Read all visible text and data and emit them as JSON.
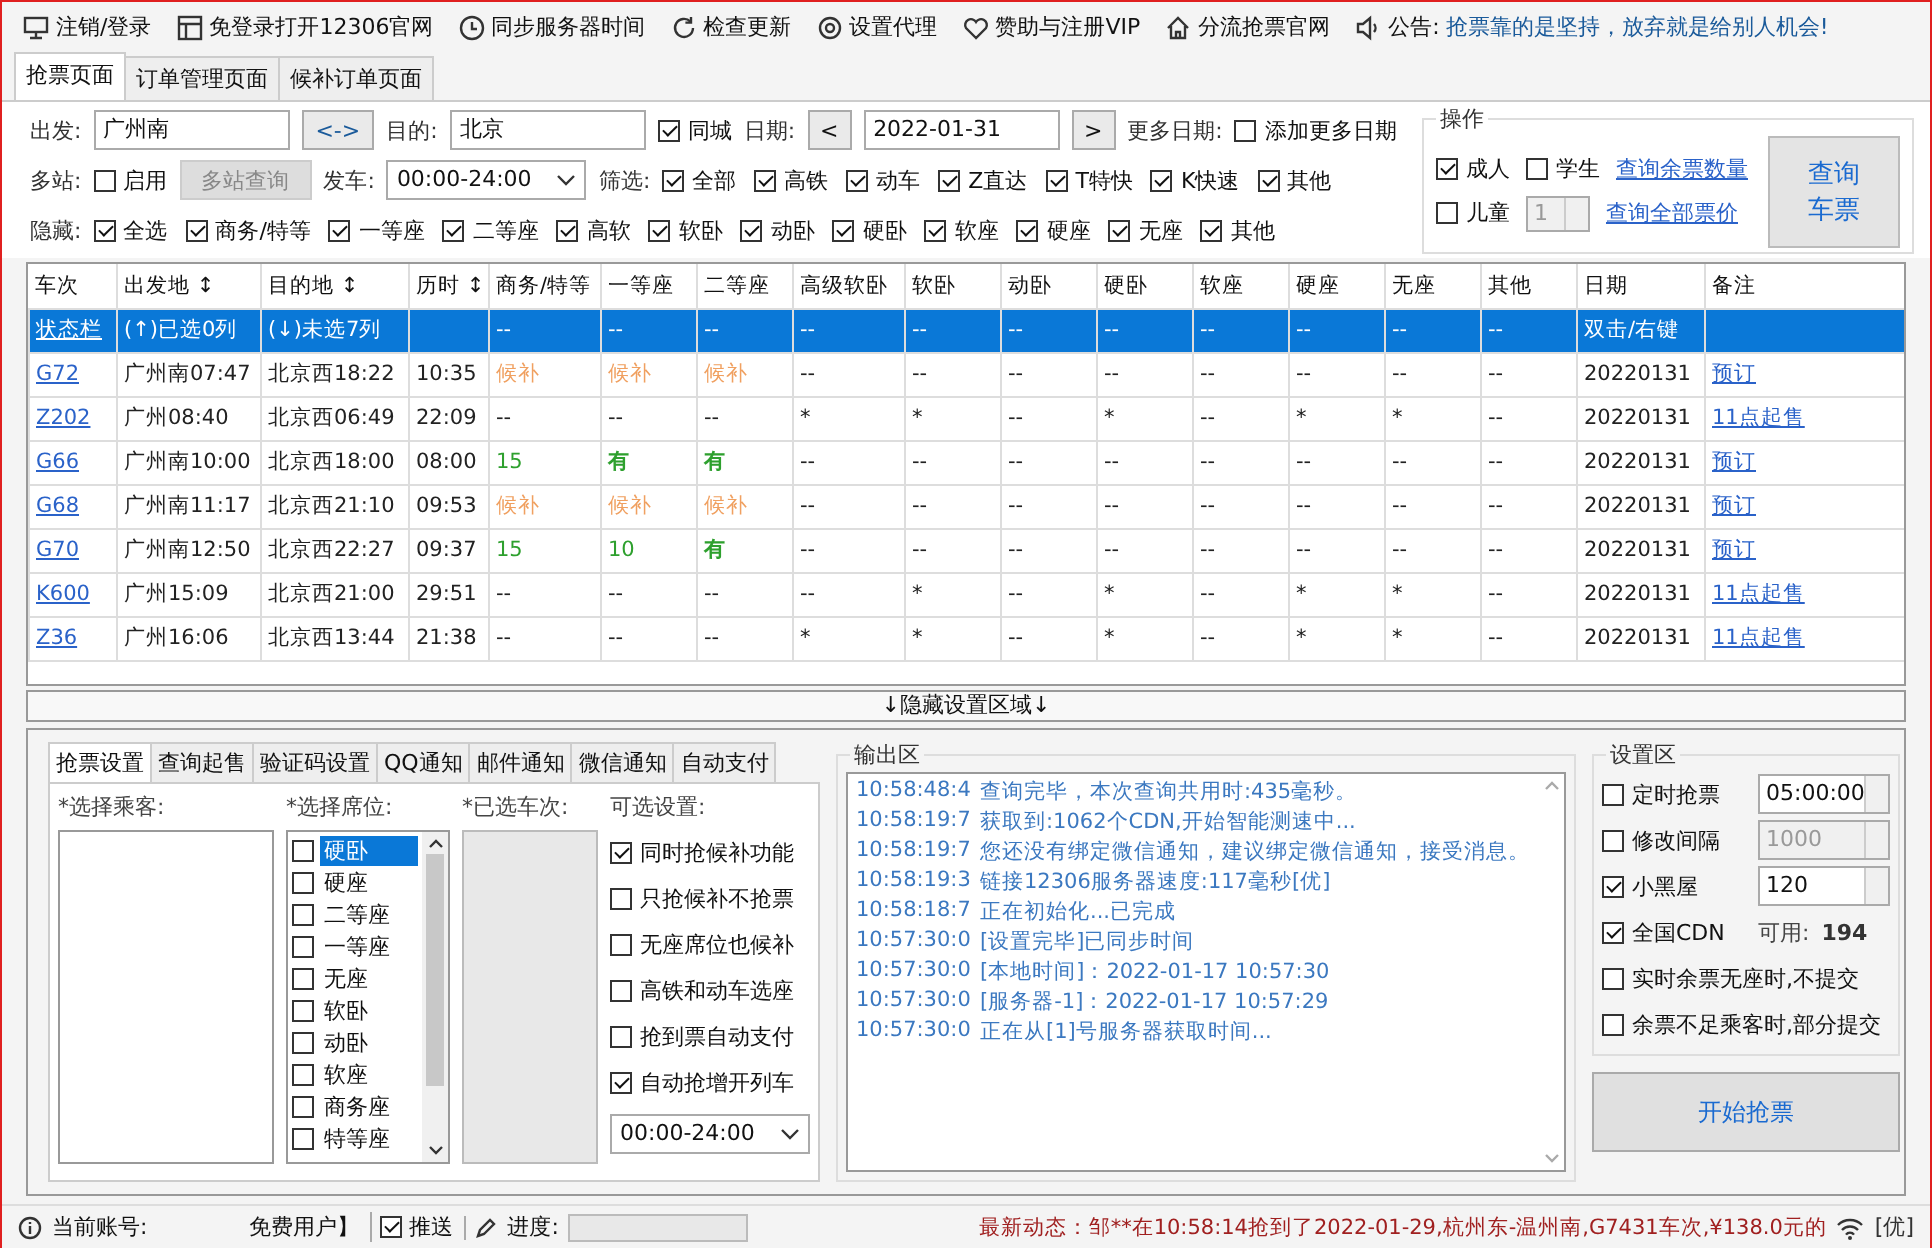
{
  "toolbar": {
    "items": [
      {
        "label": "注销/登录"
      },
      {
        "label": "免登录打开12306官网"
      },
      {
        "label": "同步服务器时间"
      },
      {
        "label": "检查更新"
      },
      {
        "label": "设置代理"
      },
      {
        "label": "赞助与注册VIP"
      },
      {
        "label": "分流抢票官网"
      }
    ],
    "notice": {
      "label": "公告:",
      "text": "抢票靠的是坚持，放弃就是给别人机会!"
    }
  },
  "tabs": [
    {
      "label": "抢票页面",
      "selected": true
    },
    {
      "label": "订单管理页面",
      "selected": false
    },
    {
      "label": "候补订单页面",
      "selected": false
    }
  ],
  "query": {
    "from_label": "出发:",
    "from": "广州南",
    "swap": "<->",
    "to_label": "目的:",
    "to": "北京",
    "same_city": {
      "label": "同城",
      "checked": true
    },
    "date_label": "日期:",
    "prev": "<",
    "date": "2022-01-31",
    "next": ">",
    "more_label": "更多日期:",
    "add_more": {
      "label": "添加更多日期",
      "checked": false
    },
    "multi_label": "多站:",
    "multi_enable": {
      "label": "启用",
      "checked": false
    },
    "multi_button": {
      "label": "多站查询",
      "disabled": true
    },
    "depart_label": "发车:",
    "depart_time": "00:00-24:00",
    "filter_label": "筛选:",
    "filters": [
      {
        "label": "全部",
        "checked": true
      },
      {
        "label": "高铁",
        "checked": true
      },
      {
        "label": "动车",
        "checked": true
      },
      {
        "label": "Z直达",
        "checked": true
      },
      {
        "label": "T特快",
        "checked": true
      },
      {
        "label": "K快速",
        "checked": true
      },
      {
        "label": "其他",
        "checked": true
      }
    ],
    "hide_label": "隐藏:",
    "hide": [
      {
        "label": "全选",
        "checked": true
      },
      {
        "label": "商务/特等",
        "checked": true
      },
      {
        "label": "一等座",
        "checked": true
      },
      {
        "label": "二等座",
        "checked": true
      },
      {
        "label": "高软",
        "checked": true
      },
      {
        "label": "软卧",
        "checked": true
      },
      {
        "label": "动卧",
        "checked": true
      },
      {
        "label": "硬卧",
        "checked": true
      },
      {
        "label": "软座",
        "checked": true
      },
      {
        "label": "硬座",
        "checked": true
      },
      {
        "label": "无座",
        "checked": true
      },
      {
        "label": "其他",
        "checked": true
      }
    ]
  },
  "operations": {
    "title": "操作",
    "adult": {
      "label": "成人",
      "checked": true
    },
    "student": {
      "label": "学生",
      "checked": false
    },
    "child": {
      "label": "儿童",
      "checked": false
    },
    "child_count": {
      "value": "1",
      "disabled": true
    },
    "links": [
      "查询余票数量",
      "查询全部票价"
    ],
    "query_button": [
      "查询",
      "车票"
    ]
  },
  "table": {
    "columns": [
      {
        "label": "车次",
        "kind": "link"
      },
      {
        "label": "出发地 ↕",
        "kind": "text"
      },
      {
        "label": "目的地 ↕",
        "kind": "text"
      },
      {
        "label": "历时 ↕",
        "kind": "text"
      },
      {
        "label": "商务/特等",
        "kind": "text"
      },
      {
        "label": "一等座",
        "kind": "text"
      },
      {
        "label": "二等座",
        "kind": "text"
      },
      {
        "label": "高级软卧",
        "kind": "text"
      },
      {
        "label": "软卧",
        "kind": "text"
      },
      {
        "label": "动卧",
        "kind": "text"
      },
      {
        "label": "硬卧",
        "kind": "text"
      },
      {
        "label": "软座",
        "kind": "text"
      },
      {
        "label": "硬座",
        "kind": "text"
      },
      {
        "label": "无座",
        "kind": "text"
      },
      {
        "label": "其他",
        "kind": "text"
      },
      {
        "label": "日期",
        "kind": "text"
      },
      {
        "label": "备注",
        "kind": "link"
      }
    ],
    "rows": [
      {
        "selected": true,
        "cells": [
          "状态栏",
          "(↑)已选0列",
          "(↓)未选7列",
          null,
          "--",
          "--",
          "--",
          "--",
          "--",
          "--",
          "--",
          "--",
          "--",
          "--",
          "--",
          "双击/右键",
          null
        ]
      },
      {
        "selected": false,
        "cells": [
          "G72",
          "广州南07:47",
          "北京西18:22",
          "10:35",
          {
            "text": "候补",
            "kind": "waitlist"
          },
          {
            "text": "候补",
            "kind": "waitlist"
          },
          {
            "text": "候补",
            "kind": "waitlist"
          },
          "--",
          "--",
          "--",
          "--",
          "--",
          "--",
          "--",
          "--",
          "20220131",
          "预订"
        ]
      },
      {
        "selected": false,
        "cells": [
          "Z202",
          "广州08:40",
          "北京西06:49",
          "22:09",
          "--",
          "--",
          "--",
          "*",
          "*",
          "--",
          "*",
          "--",
          "*",
          "*",
          "--",
          "20220131",
          "11点起售"
        ]
      },
      {
        "selected": false,
        "cells": [
          "G66",
          "广州南10:00",
          "北京西18:00",
          "08:00",
          {
            "text": "15",
            "kind": "available"
          },
          {
            "text": "有",
            "kind": "available_bold"
          },
          {
            "text": "有",
            "kind": "available_bold"
          },
          "--",
          "--",
          "--",
          "--",
          "--",
          "--",
          "--",
          "--",
          "20220131",
          "预订"
        ]
      },
      {
        "selected": false,
        "cells": [
          "G68",
          "广州南11:17",
          "北京西21:10",
          "09:53",
          {
            "text": "候补",
            "kind": "waitlist"
          },
          {
            "text": "候补",
            "kind": "waitlist"
          },
          {
            "text": "候补",
            "kind": "waitlist"
          },
          "--",
          "--",
          "--",
          "--",
          "--",
          "--",
          "--",
          "--",
          "20220131",
          "预订"
        ]
      },
      {
        "selected": false,
        "cells": [
          "G70",
          "广州南12:50",
          "北京西22:27",
          "09:37",
          {
            "text": "15",
            "kind": "available"
          },
          {
            "text": "10",
            "kind": "available"
          },
          {
            "text": "有",
            "kind": "available_bold"
          },
          "--",
          "--",
          "--",
          "--",
          "--",
          "--",
          "--",
          "--",
          "20220131",
          "预订"
        ]
      },
      {
        "selected": false,
        "cells": [
          "K600",
          "广州15:09",
          "北京西21:00",
          "29:51",
          "--",
          "--",
          "--",
          "--",
          "*",
          "--",
          "*",
          "--",
          "*",
          "*",
          "--",
          "20220131",
          "11点起售"
        ]
      },
      {
        "selected": false,
        "cells": [
          "Z36",
          "广州16:06",
          "北京西13:44",
          "21:38",
          "--",
          "--",
          "--",
          "*",
          "*",
          "--",
          "*",
          "--",
          "*",
          "*",
          "--",
          "20220131",
          "11点起售"
        ]
      }
    ]
  },
  "toggle_bar": "↓隐藏设置区域↓",
  "settings_tabs": [
    {
      "label": "抢票设置",
      "selected": true
    },
    {
      "label": "查询起售",
      "selected": false
    },
    {
      "label": "验证码设置",
      "selected": false
    },
    {
      "label": "QQ通知",
      "selected": false
    },
    {
      "label": "邮件通知",
      "selected": false
    },
    {
      "label": "微信通知",
      "selected": false
    },
    {
      "label": "自动支付",
      "selected": false
    }
  ],
  "passengers": {
    "label": "*选择乘客:"
  },
  "seats": {
    "label": "*选择席位:",
    "items": [
      {
        "label": "硬卧",
        "checked": false,
        "selected": true
      },
      {
        "label": "硬座",
        "checked": false,
        "selected": false
      },
      {
        "label": "二等座",
        "checked": false,
        "selected": false
      },
      {
        "label": "一等座",
        "checked": false,
        "selected": false
      },
      {
        "label": "无座",
        "checked": false,
        "selected": false
      },
      {
        "label": "软卧",
        "checked": false,
        "selected": false
      },
      {
        "label": "动卧",
        "checked": false,
        "selected": false
      },
      {
        "label": "软座",
        "checked": false,
        "selected": false
      },
      {
        "label": "商务座",
        "checked": false,
        "selected": false
      },
      {
        "label": "特等座",
        "checked": false,
        "selected": false
      }
    ]
  },
  "selected_trains": {
    "label": "*已选车次:"
  },
  "options": {
    "label": "可选设置:",
    "items": [
      {
        "label": "同时抢候补功能",
        "checked": true
      },
      {
        "label": "只抢候补不抢票",
        "checked": false
      },
      {
        "label": "无座席位也候补",
        "checked": false
      },
      {
        "label": "高铁和动车选座",
        "checked": false
      },
      {
        "label": "抢到票自动支付",
        "checked": false
      },
      {
        "label": "自动抢增开列车",
        "checked": true
      }
    ],
    "time_range": "00:00-24:00"
  },
  "output": {
    "title": "输出区",
    "lines": [
      {
        "time": "10:58:48:4",
        "text": "查询完毕，本次查询共用时:435毫秒。"
      },
      {
        "time": "10:58:19:7",
        "text": "获取到:1062个CDN,开始智能测速中..."
      },
      {
        "time": "10:58:19:7",
        "text": "您还没有绑定微信通知，建议绑定微信通知，接受消息。"
      },
      {
        "time": "10:58:19:3",
        "text": "链接12306服务器速度:117毫秒[优]"
      },
      {
        "time": "10:58:18:7",
        "text": "正在初始化...已完成"
      },
      {
        "time": "10:57:30:0",
        "text": "[设置完毕]已同步时间"
      },
      {
        "time": "10:57:30:0",
        "text": "[本地时间]：2022-01-17 10:57:30"
      },
      {
        "time": "10:57:30:0",
        "text": "[服务器-1]：2022-01-17 10:57:29"
      },
      {
        "time": "10:57:30:0",
        "text": "正在从[1]号服务器获取时间..."
      }
    ]
  },
  "settings": {
    "title": "设置区",
    "rows": [
      {
        "kind": "spin",
        "label": "定时抢票",
        "checked": false,
        "value": "05:00:00",
        "disabled": false
      },
      {
        "kind": "spin",
        "label": "修改间隔",
        "checked": false,
        "value": "1000",
        "disabled": true
      },
      {
        "kind": "spin",
        "label": "小黑屋",
        "checked": true,
        "value": "120",
        "disabled": false
      },
      {
        "kind": "stat",
        "label": "全国CDN",
        "checked": true,
        "stat_label": "可用:",
        "stat_value": "194"
      },
      {
        "kind": "check",
        "label": "实时余票无座时,不提交",
        "checked": false
      },
      {
        "kind": "check",
        "label": "余票不足乘客时,部分提交",
        "checked": false
      }
    ],
    "start_button": "开始抢票"
  },
  "status_bar": {
    "account_label": "当前账号:",
    "account": "免费用户】",
    "push": {
      "label": "推送",
      "checked": true
    },
    "progress_label": "进度:",
    "progress": {
      "level": 0
    },
    "news": "最新动态：邹**在10:58:14抢到了2022-01-29,杭州东-温州南,G7431车次,¥138.0元的",
    "signal": "[优]"
  }
}
